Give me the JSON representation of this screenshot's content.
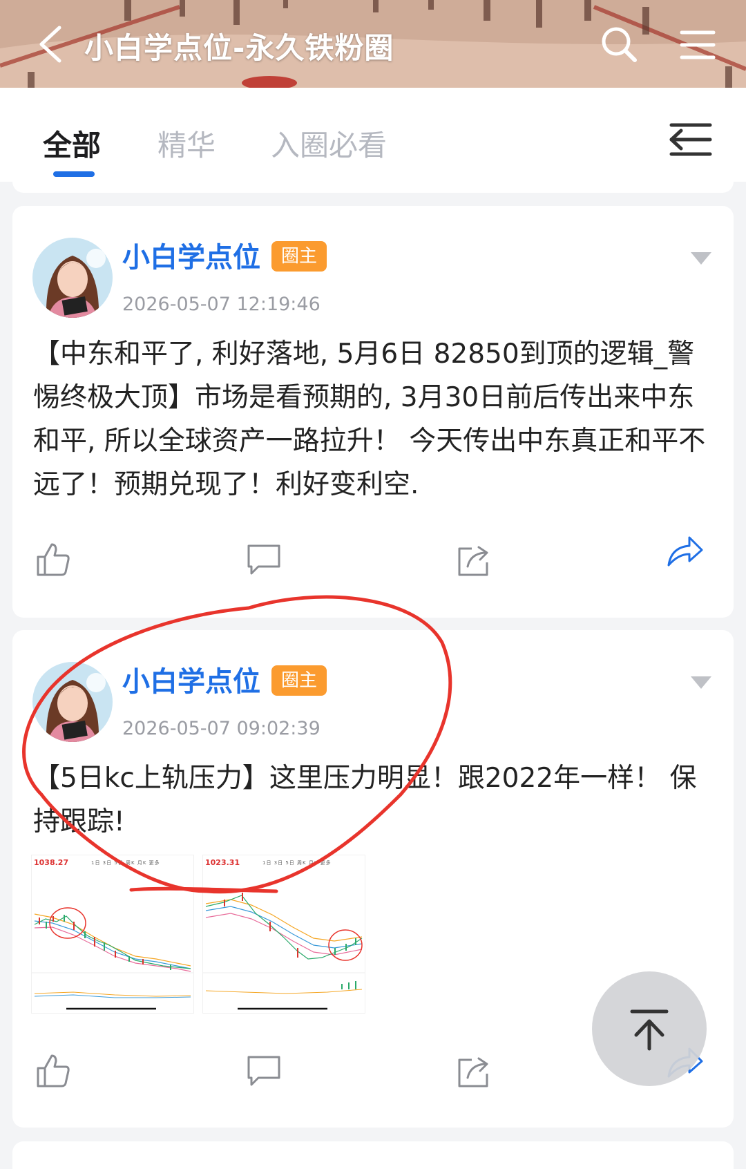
{
  "header": {
    "title": "小白学点位-永久铁粉圈",
    "back_icon": "chevron-left-icon",
    "search_icon": "search-icon",
    "menu_icon": "hamburger-menu-icon"
  },
  "tabs": {
    "items": [
      {
        "label": "全部",
        "active": true
      },
      {
        "label": "精华",
        "active": false
      },
      {
        "label": "入圈必看",
        "active": false
      }
    ],
    "sort_icon": "sort-list-icon",
    "accent_color": "#1f6fe5"
  },
  "posts": [
    {
      "author": "小白学点位",
      "badge": "圈主",
      "time": "2026-05-07 12:19:46",
      "content": "【中东和平了, 利好落地, 5月6日 82850到顶的逻辑_警惕终极大顶】市场是看预期的, 3月30日前后传出来中东和平, 所以全球资产一路拉升！ 今天传出中东真正和平不远了！预期兑现了！利好变利空."
    },
    {
      "author": "小白学点位",
      "badge": "圈主",
      "time": "2026-05-07 09:02:39",
      "content": "【5日kc上轨压力】这里压力明显！跟2022年一样！ 保持跟踪!",
      "images": [
        {
          "price": "1038.27",
          "ranges": "1日 3日 5日 周K 月K 更多"
        },
        {
          "price": "1023.31",
          "ranges": "1日 3日 5日 周K 月K 更多"
        }
      ]
    }
  ],
  "colors": {
    "author": "#1f6fe5",
    "badge": "#fb9b2f",
    "annotation": "#e8342c"
  },
  "back_to_top_icon": "arrow-up-to-top-icon"
}
